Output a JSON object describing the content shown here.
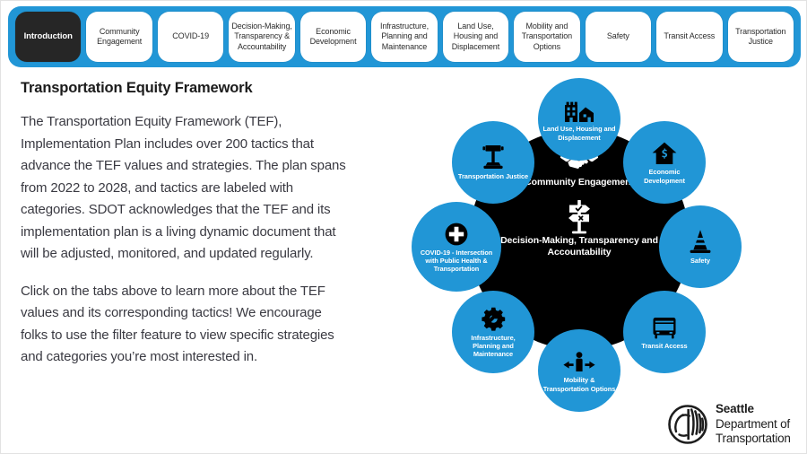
{
  "theme": {
    "accent_blue": "#2196d6",
    "hub_black": "#000000",
    "active_tab_bg": "#262626",
    "tab_bg": "#ffffff",
    "page_bg": "#ffffff",
    "body_text": "#3a3a42"
  },
  "tabs": [
    {
      "label": "Introduction",
      "active": true
    },
    {
      "label": "Community Engagement",
      "active": false
    },
    {
      "label": "COVID-19",
      "active": false
    },
    {
      "label": "Decision-Making, Transparency & Accountability",
      "active": false
    },
    {
      "label": "Economic Development",
      "active": false
    },
    {
      "label": "Infrastructure, Planning and Maintenance",
      "active": false
    },
    {
      "label": "Land Use, Housing and Displacement",
      "active": false
    },
    {
      "label": "Mobility and Transportation Options",
      "active": false
    },
    {
      "label": "Safety",
      "active": false
    },
    {
      "label": "Transit Access",
      "active": false
    },
    {
      "label": "Transportation Justice",
      "active": false
    }
  ],
  "content": {
    "heading": "Transportation Equity Framework",
    "paragraph1": "The Transportation Equity Framework (TEF), Implementation Plan includes over 200 tactics that advance the TEF values and strategies. The plan spans from 2022 to 2028, and tactics are labeled with categories. SDOT acknowledges that the TEF and its implementation plan is a living dynamic document that will be adjusted, monitored, and updated regularly.",
    "paragraph2": "Click on the tabs above to learn more about the TEF values and its corresponding tactics! We encourage folks to use the filter feature to view specific strategies and categories you’re most interested in."
  },
  "wheel": {
    "center": [
      {
        "label": "Community Engagement",
        "icon": "handshake-icon"
      },
      {
        "label": "Decision-Making, Transparency and Accountability",
        "icon": "signpost-icon"
      }
    ],
    "nodes": [
      {
        "label": "Land Use, Housing and Displacement",
        "icon": "buildings-icon"
      },
      {
        "label": "Economic Development",
        "icon": "house-dollar-arrow-icon"
      },
      {
        "label": "Safety",
        "icon": "traffic-cone-icon"
      },
      {
        "label": "Transit Access",
        "icon": "bus-icon"
      },
      {
        "label": "Mobility & Transportation Options",
        "icon": "pedestrian-arrows-icon"
      },
      {
        "label": "Infrastructure, Planning and Maintenance",
        "icon": "gear-wrench-icon"
      },
      {
        "label": "COVID-19 - Intersection with Public Health & Transportation",
        "icon": "medical-cross-icon"
      },
      {
        "label": "Transportation Justice",
        "icon": "gavel-icon"
      }
    ]
  },
  "logo": {
    "line1": "Seattle",
    "line2": "Department of",
    "line3": "Transportation",
    "mark": "seattle-city-seal-icon"
  }
}
